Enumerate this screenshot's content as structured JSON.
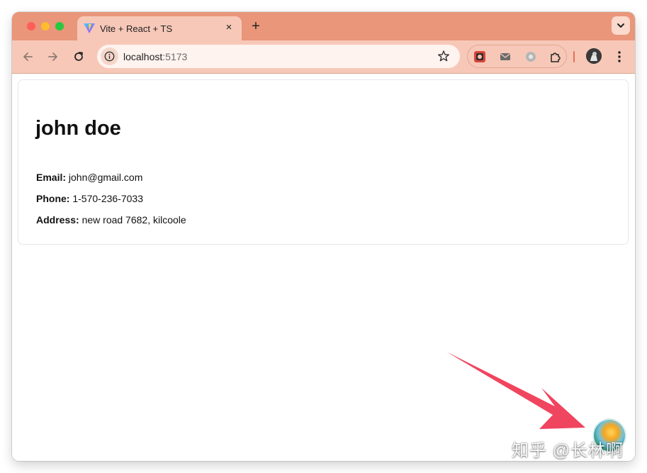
{
  "browser": {
    "tab": {
      "title": "Vite + React + TS",
      "close_glyph": "×"
    },
    "new_tab_glyph": "+",
    "url": {
      "host": "localhost",
      "port": ":5173"
    },
    "colors": {
      "frame": "#e9967a",
      "tab": "#f7c8b8"
    }
  },
  "page": {
    "name": "john doe",
    "fields": [
      {
        "label": "Email:",
        "value": "john@gmail.com"
      },
      {
        "label": "Phone:",
        "value": "1-570-236-7033"
      },
      {
        "label": "Address:",
        "value": "new road 7682, kilcoole"
      }
    ]
  },
  "overlay": {
    "arrow_color": "#f0455f",
    "watermark": "知乎 @长林啊"
  }
}
